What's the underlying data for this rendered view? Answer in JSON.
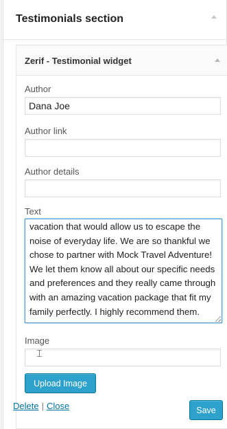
{
  "section": {
    "title": "Testimonials section"
  },
  "widget": {
    "title": "Zerif - Testimonial widget",
    "author_label": "Author",
    "author_value": "Dana Joe",
    "author_link_label": "Author link",
    "author_link_value": "",
    "author_details_label": "Author details",
    "author_details_value": "",
    "text_label": "Text",
    "text_value": "vacation that would allow us to escape the noise of everyday life.  We are so thankful we chose to partner with Mock Travel Adventure!  We let them know all about our specific needs and preferences and they really came through with an amazing vacation package that fit my family perfectly.  I highly recommend them.",
    "image_label": "Image",
    "image_value": "",
    "upload_button_label": "Upload Image",
    "delete_link": "Delete",
    "separator": "|",
    "close_link": "Close",
    "save_button_label": "Save"
  },
  "colors": {
    "primary_button": "#2ea2cc",
    "link": "#0074a2",
    "focus_border": "#5b9dd9"
  },
  "icons": {
    "section_toggle": "arrow-up-icon",
    "widget_toggle": "arrow-up-icon",
    "mouse_cursor": "text-cursor-icon"
  }
}
